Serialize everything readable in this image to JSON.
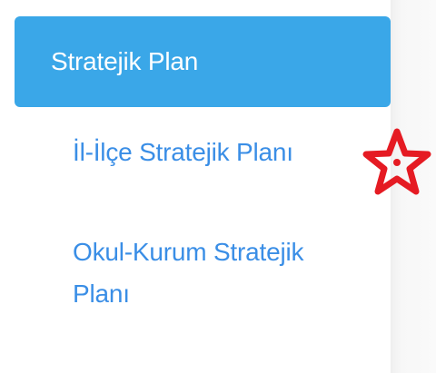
{
  "sidebar": {
    "active_item": {
      "label": "Stratejik Plan"
    },
    "sub_items": [
      {
        "label": "İl-İlçe Stratejik Planı"
      },
      {
        "label": "Okul-Kurum Stratejik Planı"
      }
    ]
  },
  "annotation": {
    "icon": "star-icon",
    "color": "#e51b23"
  },
  "colors": {
    "active_background": "#3aa7e8",
    "active_text": "#ffffff",
    "link_text": "#3a8ee6"
  }
}
